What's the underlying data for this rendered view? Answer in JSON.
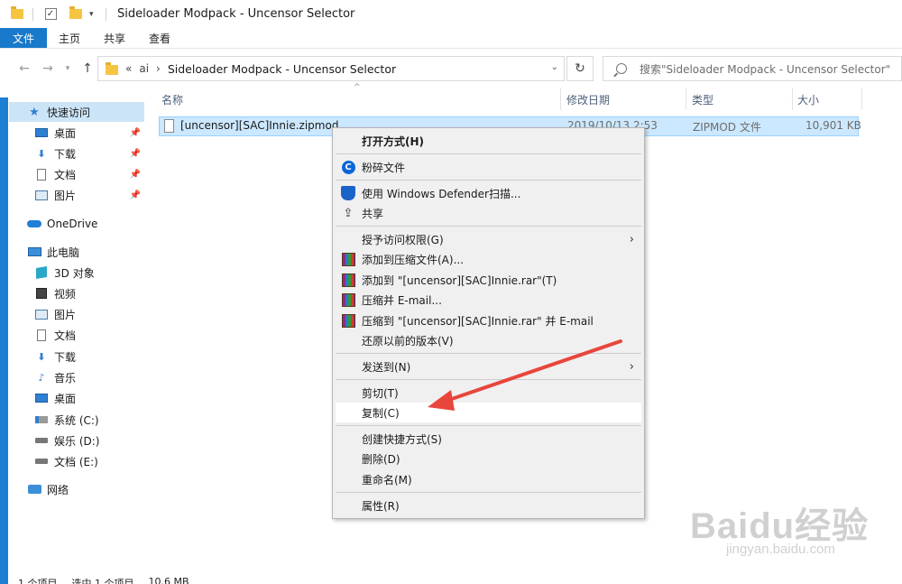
{
  "window": {
    "title": "Sideloader Modpack - Uncensor Selector"
  },
  "ribbon": {
    "tabs": [
      "文件",
      "主页",
      "共享",
      "查看"
    ]
  },
  "address": {
    "ellipsis": "«",
    "crumb_root": "ai",
    "crumb_current": "Sideloader Modpack - Uncensor Selector"
  },
  "search": {
    "placeholder": "搜索\"Sideloader Modpack - Uncensor Selector\""
  },
  "nav": {
    "quick_access": "快速访问",
    "pinned": [
      {
        "label": "桌面",
        "icon": "desktop-icon"
      },
      {
        "label": "下载",
        "icon": "download-icon"
      },
      {
        "label": "文档",
        "icon": "document-icon"
      },
      {
        "label": "图片",
        "icon": "pictures-icon"
      }
    ],
    "onedrive": "OneDrive",
    "this_pc": "此电脑",
    "pc_items": [
      {
        "label": "3D 对象",
        "icon": "3d-objects-icon"
      },
      {
        "label": "视频",
        "icon": "video-icon"
      },
      {
        "label": "图片",
        "icon": "pictures-icon"
      },
      {
        "label": "文档",
        "icon": "document-icon"
      },
      {
        "label": "下载",
        "icon": "download-icon"
      },
      {
        "label": "音乐",
        "icon": "music-icon"
      },
      {
        "label": "桌面",
        "icon": "desktop-icon"
      },
      {
        "label": "系统 (C:)",
        "icon": "system-drive-icon"
      },
      {
        "label": "娱乐 (D:)",
        "icon": "drive-icon"
      },
      {
        "label": "文档 (E:)",
        "icon": "drive-icon"
      }
    ],
    "network": "网络"
  },
  "columns": {
    "name": "名称",
    "modified": "修改日期",
    "type": "类型",
    "size": "大小"
  },
  "file": {
    "name": "[uncensor][SAC]Innie.zipmod",
    "modified": "2019/10/13 2:53",
    "type": "ZIPMOD 文件",
    "size": "10,901 KB"
  },
  "status": {
    "count": "1 个项目",
    "selected": "选中 1 个项目",
    "size": "10.6 MB"
  },
  "context_menu": {
    "open_with": "打开方式(H)",
    "shred": "粉碎文件",
    "defender": "使用 Windows Defender扫描...",
    "share": "共享",
    "grant_access": "授予访问权限(G)",
    "add_archive": "添加到压缩文件(A)...",
    "add_rar": "添加到 \"[uncensor][SAC]Innie.rar\"(T)",
    "compress_email": "压缩并 E-mail...",
    "compress_rar_email": "压缩到 \"[uncensor][SAC]Innie.rar\" 并 E-mail",
    "restore": "还原以前的版本(V)",
    "send_to": "发送到(N)",
    "cut": "剪切(T)",
    "copy": "复制(C)",
    "shortcut": "创建快捷方式(S)",
    "delete": "删除(D)",
    "rename": "重命名(M)",
    "properties": "属性(R)"
  },
  "watermark": {
    "logo": "Baidu经验",
    "url": "jingyan.baidu.com"
  },
  "colors": {
    "accent": "#1979ca",
    "selection": "#cce8ff",
    "annotation_arrow": "#e8463c"
  }
}
